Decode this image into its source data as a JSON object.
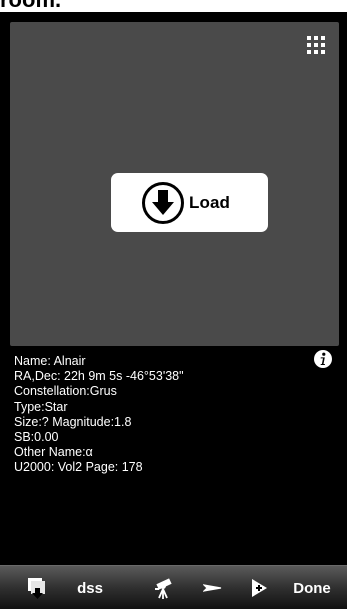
{
  "top_strip": {
    "text": "room."
  },
  "load_button": {
    "label": "Load",
    "icon": "download-arrow-icon"
  },
  "object_info": {
    "name": "Name: Alnair",
    "ra_dec": "RA,Dec: 22h 9m 5s -46°53'38\"",
    "constellation": "Constellation:Grus",
    "type": "Type:Star",
    "size_magnitude": "Size:? Magnitude:1.8",
    "sb": "SB:0.00",
    "other_name": "Other Name:α",
    "u2000": "U2000: Vol2 Page: 178"
  },
  "toolbar": {
    "dss_label": "dss",
    "done_label": "Done",
    "icons": [
      "stack-arrow-icon",
      "telescope-icon",
      "pointer-arrow-icon",
      "add-plus-icon",
      "info-icon",
      "grid-menu-icon"
    ]
  },
  "colors": {
    "panel_bg": "#4a4a4a",
    "screen_bg": "#000000",
    "button_bg": "#ffffff"
  }
}
